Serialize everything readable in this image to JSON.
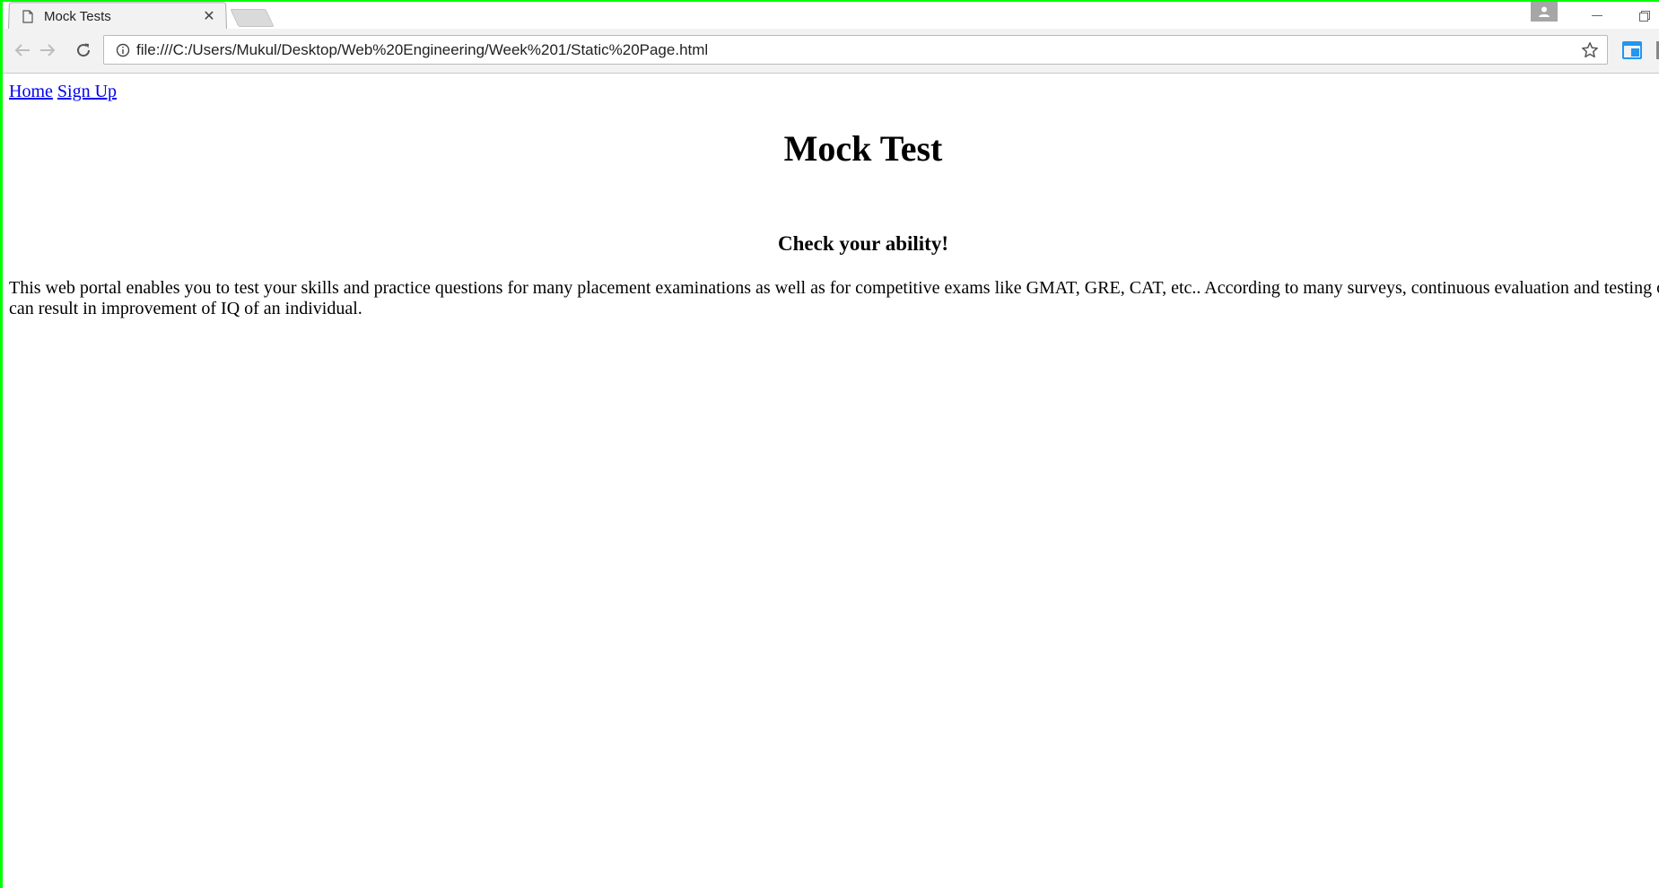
{
  "browser": {
    "tab": {
      "title": "Mock Tests",
      "close_glyph": "✕",
      "icon": "page-icon"
    },
    "address_bar": {
      "url": "file:///C:/Users/Mukul/Desktop/Web%20Engineering/Week%201/Static%20Page.html",
      "info_icon": "info-icon",
      "bookmark_icon": "star-icon"
    },
    "toolbar_icons": [
      "back-icon",
      "forward-icon",
      "reload-icon"
    ],
    "window_controls": [
      "profile-icon",
      "minimize-icon",
      "restore-icon"
    ]
  },
  "page": {
    "nav": {
      "home_label": "Home",
      "signup_label": "Sign Up"
    },
    "title": "Mock Test",
    "subtitle": "Check your ability!",
    "body": "This web portal enables you to test your skills and practice questions for many placement examinations as well as for competitive exams like GMAT, GRE, CAT, etc.. According to many surveys, continuous evaluation and testing of skills can result in improvement of IQ of an individual."
  },
  "colors": {
    "frame": "#00ff00",
    "link": "#0000ee",
    "toolbar_bg": "#f2f2f2",
    "extension_accent": "#2196f3"
  }
}
